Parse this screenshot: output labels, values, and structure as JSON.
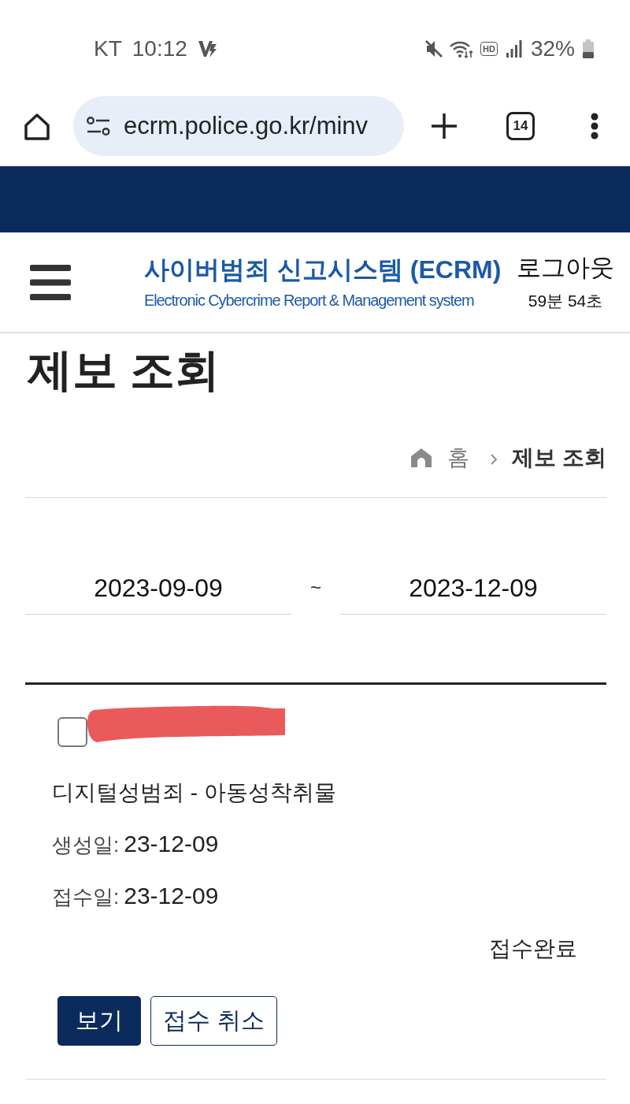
{
  "status_bar": {
    "carrier": "KT",
    "time": "10:12",
    "network_badge": "HD",
    "battery": "32%"
  },
  "browser": {
    "url": "ecrm.police.go.kr/minv",
    "tab_count": "14"
  },
  "header": {
    "title": "사이버범죄 신고시스템 (ECRM)",
    "subtitle": "Electronic Cybercrime Report & Management system",
    "logout": "로그아웃",
    "session_timer": "59분 54초"
  },
  "page_title": "제보 조회",
  "breadcrumb": [
    {
      "kind": "home",
      "label": "홈",
      "current": false
    },
    {
      "kind": "page",
      "label": "제보 조회",
      "current": true
    }
  ],
  "date_range": {
    "start": "2023-09-09",
    "separator": "~",
    "end": "2023-12-09"
  },
  "reports": [
    {
      "checked": false,
      "redacted": true,
      "category": "디지털성범죄 - 아동성착취물",
      "fields": [
        {
          "label": "생성일:",
          "value": "23-12-09"
        },
        {
          "label": "접수일:",
          "value": "23-12-09"
        }
      ],
      "status": "접수완료",
      "actions": [
        {
          "label": "보기",
          "kind": "primary"
        },
        {
          "label": "접수 취소",
          "kind": "secondary"
        }
      ]
    }
  ]
}
